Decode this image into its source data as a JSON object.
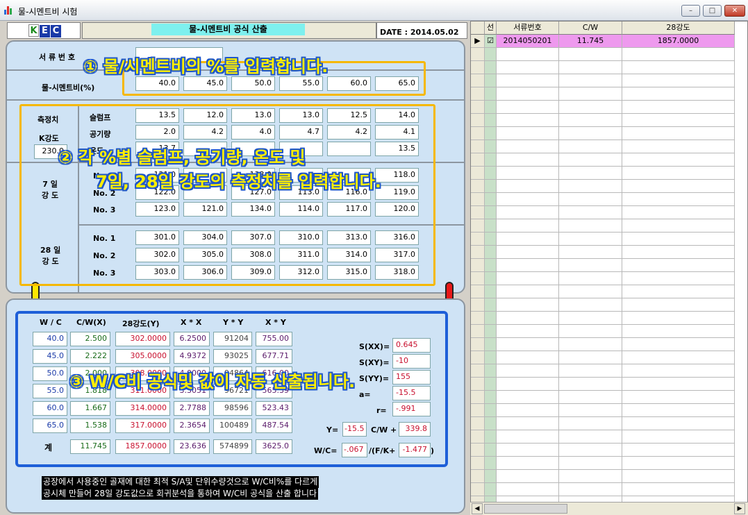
{
  "window": {
    "title": "물-시멘트비 시험",
    "minimize": "–",
    "maximize": "□",
    "close": "✕"
  },
  "logo": {
    "letters": [
      "K",
      "E",
      "C"
    ],
    "colors": [
      "#1a8a1a",
      "#1a3aa8",
      "#1a3aa8"
    ]
  },
  "header": {
    "title": "물-시멘트비 공식 산출",
    "date_label": "DATE :",
    "date": "2014.05.02"
  },
  "top": {
    "serial_label": "서 류 번 호",
    "ratio_label": "물-시멘트비(%)",
    "ratios": [
      "40.0",
      "45.0",
      "50.0",
      "55.0",
      "60.0",
      "65.0"
    ]
  },
  "measure": {
    "section_label": "측정치",
    "k_label": "K강도",
    "k_value": "230.0",
    "slump_label": "슬럼프",
    "slump": [
      "13.5",
      "12.0",
      "13.0",
      "13.0",
      "12.5",
      "14.0"
    ],
    "air_label": "공기량",
    "air": [
      "2.0",
      "4.2",
      "4.0",
      "4.7",
      "4.2",
      "4.1"
    ],
    "temp_label": "온도",
    "temp": [
      "13.7",
      "",
      "",
      "",
      "",
      "13.5"
    ],
    "day7_label": "7 일\n강 도",
    "d7_no1_label": "No. 1",
    "d7_no1": [
      "121.0",
      "",
      "133.0",
      "",
      "",
      "118.0"
    ],
    "d7_no2_label": "No. 2",
    "d7_no2": [
      "122.0",
      "",
      "127.0",
      "113.0",
      "116.0",
      "119.0"
    ],
    "d7_no3_label": "No. 3",
    "d7_no3": [
      "123.0",
      "121.0",
      "134.0",
      "114.0",
      "117.0",
      "120.0"
    ],
    "day28_label": "28 일\n강 도",
    "d28_no1_label": "No. 1",
    "d28_no1": [
      "301.0",
      "304.0",
      "307.0",
      "310.0",
      "313.0",
      "316.0"
    ],
    "d28_no2_label": "No. 2",
    "d28_no2": [
      "302.0",
      "305.0",
      "308.0",
      "311.0",
      "314.0",
      "317.0"
    ],
    "d28_no3_label": "No. 3",
    "d28_no3": [
      "303.0",
      "306.0",
      "309.0",
      "312.0",
      "315.0",
      "318.0"
    ]
  },
  "calc": {
    "headers": [
      "W / C",
      "C/W(X)",
      "28강도(Y)",
      "X * X",
      "Y * Y",
      "X * Y"
    ],
    "rows": [
      [
        "40.0",
        "2.500",
        "302.0000",
        "6.2500",
        "91204",
        "755.00"
      ],
      [
        "45.0",
        "2.222",
        "305.0000",
        "4.9372",
        "93025",
        "677.71"
      ],
      [
        "50.0",
        "2.000",
        "308.0000",
        "4.0000",
        "94864",
        "616.00"
      ],
      [
        "55.0",
        "1.818",
        "311.0000",
        "3.3051",
        "96721",
        "565.39"
      ],
      [
        "60.0",
        "1.667",
        "314.0000",
        "2.7788",
        "98596",
        "523.43"
      ],
      [
        "65.0",
        "1.538",
        "317.0000",
        "2.3654",
        "100489",
        "487.54"
      ]
    ],
    "total_label": "계",
    "totals": [
      "11.745",
      "1857.0000",
      "23.636",
      "574899",
      "3625.0"
    ],
    "sxx_label": "S(XX)=",
    "sxx": "0.645",
    "sxy_label": "S(XY)=",
    "sxy": "-10",
    "syy_label": "S(YY)=",
    "syy": "155",
    "slope_label": "a=",
    "slope": "-15.5",
    "r_label": "r=",
    "r": "-.991",
    "eq1_y": "Y=",
    "eq1_a": "-15.5",
    "eq1_cw": "C/W +",
    "eq1_b": "339.8",
    "eq2_wc": "W/C=",
    "eq2_a": "-.067",
    "eq2_fk": "/(F/K+",
    "eq2_b": "-1.477",
    "eq2_close": ")"
  },
  "annotations": {
    "a1": "① 물/시멘트비의 %를 입력합니다.",
    "a2": "② 각 %별 슬럼프, 공기량, 온도 및",
    "a2b": "7일, 28일 강도의 측정치를 입력합니다.",
    "a3": "③ W/C비 공식및 값이 자동 산출됩니다."
  },
  "note": {
    "line1": "공장에서 사용중인 골재에 대한 최적 S/A및 단위수량것으로 W/C비%를 다르게",
    "line2": "공시체 만들어 28일 강도값으로 회귀분석을 통하여 W/C비 공식을 산출 합니다"
  },
  "grid": {
    "headers": [
      "선",
      "서류번호",
      "C/W",
      "28강도"
    ],
    "row": {
      "marker": "▶",
      "checked": "☑",
      "serial": "2014050201",
      "cw": "11.745",
      "strength": "1857.0000"
    }
  },
  "colors": {
    "selected_row": "#ee99ee",
    "panel": "#cfe3f5",
    "callout_yellow": "#f5b800",
    "callout_blue": "#1e5fd8"
  }
}
